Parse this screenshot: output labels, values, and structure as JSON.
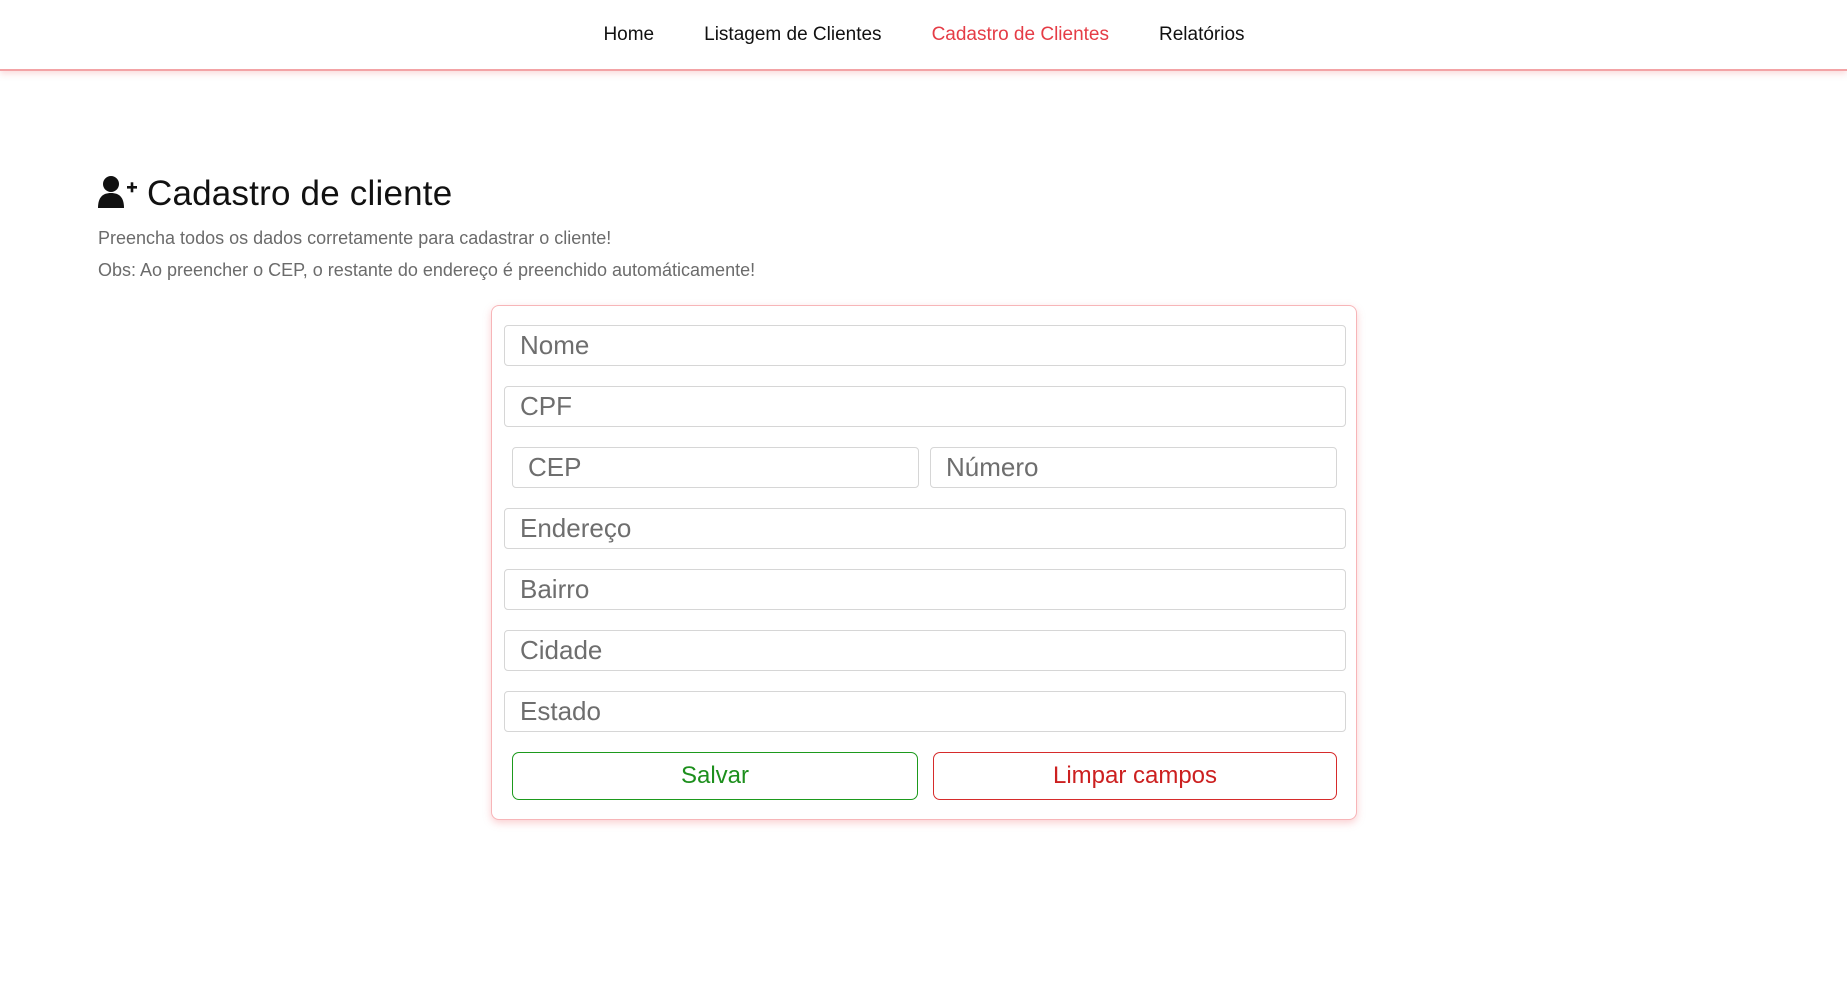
{
  "nav": {
    "items": [
      {
        "label": "Home",
        "active": false
      },
      {
        "label": "Listagem de Clientes",
        "active": false
      },
      {
        "label": "Cadastro de Clientes",
        "active": true
      },
      {
        "label": "Relatórios",
        "active": false
      }
    ],
    "active_color": "#e53c46"
  },
  "header": {
    "icon": "user-plus-icon",
    "title": "Cadastro de cliente",
    "subtitle": "Preencha todos os dados corretamente para cadastrar o cliente!",
    "note": "Obs: Ao preencher o CEP, o restante do endereço é preenchido automáticamente!"
  },
  "form": {
    "nome_placeholder": "Nome",
    "cpf_placeholder": "CPF",
    "cep_placeholder": "CEP",
    "numero_placeholder": "Número",
    "endereco_placeholder": "Endereço",
    "bairro_placeholder": "Bairro",
    "cidade_placeholder": "Cidade",
    "estado_placeholder": "Estado",
    "save_label": "Salvar",
    "clear_label": "Limpar campos"
  }
}
